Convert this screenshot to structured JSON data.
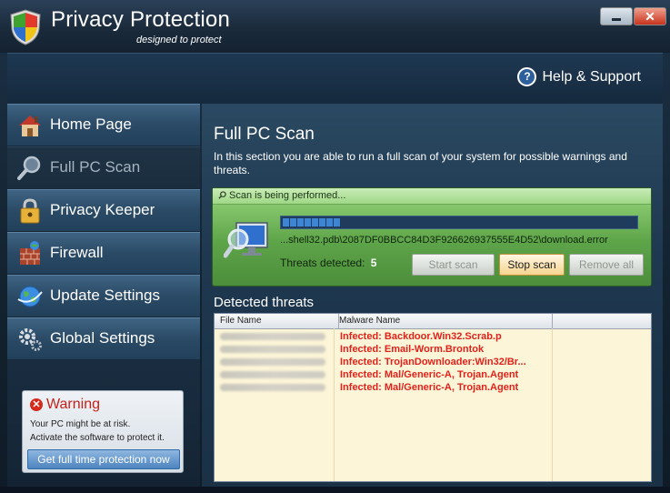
{
  "window": {
    "title": "Privacy Protection",
    "subtitle": "designed to protect",
    "colors": {
      "accent": "#2c5f9c",
      "warning": "#e0221b",
      "scan_green": "#5ea449"
    }
  },
  "header": {
    "help_label": "Help & Support",
    "help_icon": "question-icon"
  },
  "sidebar": {
    "items": [
      {
        "label": "Home Page",
        "icon": "house-icon"
      },
      {
        "label": "Full PC Scan",
        "icon": "magnifier-icon"
      },
      {
        "label": "Privacy Keeper",
        "icon": "padlock-icon"
      },
      {
        "label": "Firewall",
        "icon": "brick-wall-icon"
      },
      {
        "label": "Update Settings",
        "icon": "globe-icon"
      },
      {
        "label": "Global Settings",
        "icon": "gears-icon"
      }
    ],
    "active_index": 1,
    "warning": {
      "title": "Warning",
      "line1": "Your PC might be at risk.",
      "line2": "Activate the software to protect it.",
      "button": "Get full time protection now"
    }
  },
  "main": {
    "title": "Full PC Scan",
    "description": "In this section you are able to run a full scan of your system for possible warnings and threats.",
    "scan": {
      "status": "Scan is being performed...",
      "progress": 0.16,
      "current_file": "...shell32.pdb\\2087DF0BBCC84D3F926626937555E4D52\\download.error",
      "threats_label": "Threats detected:",
      "threats_count": "5",
      "buttons": {
        "start": "Start scan",
        "stop": "Stop scan",
        "remove": "Remove all"
      }
    },
    "detected": {
      "title": "Detected threats",
      "columns": [
        "File Name",
        "Malware Name"
      ],
      "rows": [
        {
          "malware": "Infected: Backdoor.Win32.Scrab.p"
        },
        {
          "malware": "Infected: Email-Worm.Brontok"
        },
        {
          "malware": "Infected: TrojanDownloader:Win32/Br..."
        },
        {
          "malware": "Infected: Mal/Generic-A, Trojan.Agent"
        },
        {
          "malware": "Infected: Mal/Generic-A, Trojan.Agent"
        }
      ]
    }
  }
}
